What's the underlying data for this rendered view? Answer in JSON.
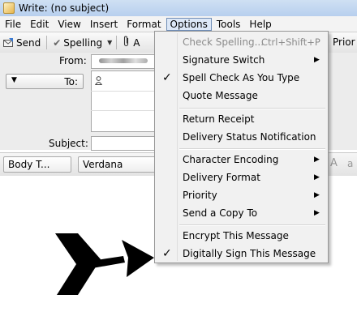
{
  "window": {
    "title": "Write: (no subject)"
  },
  "menubar": {
    "items": [
      {
        "label": "File",
        "active": false
      },
      {
        "label": "Edit",
        "active": false
      },
      {
        "label": "View",
        "active": false
      },
      {
        "label": "Insert",
        "active": false
      },
      {
        "label": "Format",
        "active": false
      },
      {
        "label": "Options",
        "active": true
      },
      {
        "label": "Tools",
        "active": false
      },
      {
        "label": "Help",
        "active": false
      }
    ]
  },
  "toolbar": {
    "send_label": "Send",
    "spelling_label": "Spelling",
    "attach_partial": "A",
    "priority_partial": "Prior"
  },
  "header": {
    "from_label": "From:",
    "to_label": "To:",
    "subject_label": "Subject:",
    "subject_value": ""
  },
  "format": {
    "body_text": "Body T...",
    "font": "Verdana",
    "size_large": "A",
    "size_small": "a"
  },
  "options_menu": {
    "items": [
      {
        "label": "Check Spelling...",
        "shortcut": "Ctrl+Shift+P",
        "enabled": false,
        "checked": false,
        "submenu": false
      },
      {
        "label": "Signature Switch",
        "shortcut": "",
        "enabled": true,
        "checked": false,
        "submenu": true
      },
      {
        "label": "Spell Check As You Type",
        "shortcut": "",
        "enabled": true,
        "checked": true,
        "submenu": false
      },
      {
        "label": "Quote Message",
        "shortcut": "",
        "enabled": true,
        "checked": false,
        "submenu": false
      },
      {
        "label": "Return Receipt",
        "shortcut": "",
        "enabled": true,
        "checked": false,
        "submenu": false
      },
      {
        "label": "Delivery Status Notification",
        "shortcut": "",
        "enabled": true,
        "checked": false,
        "submenu": false
      },
      {
        "label": "Character Encoding",
        "shortcut": "",
        "enabled": true,
        "checked": false,
        "submenu": true
      },
      {
        "label": "Delivery Format",
        "shortcut": "",
        "enabled": true,
        "checked": false,
        "submenu": true
      },
      {
        "label": "Priority",
        "shortcut": "",
        "enabled": true,
        "checked": false,
        "submenu": true
      },
      {
        "label": "Send a Copy To",
        "shortcut": "",
        "enabled": true,
        "checked": false,
        "submenu": true
      },
      {
        "label": "Encrypt This Message",
        "shortcut": "",
        "enabled": true,
        "checked": false,
        "submenu": false
      },
      {
        "label": "Digitally Sign This Message",
        "shortcut": "",
        "enabled": true,
        "checked": true,
        "submenu": false
      }
    ]
  },
  "icons": {
    "check_mark": "✓",
    "submenu_arrow": "▶",
    "dropdown_arrow": "▼"
  },
  "colors": {
    "menu_active_bg": "#dde8f7",
    "menu_active_border": "#6f8db6",
    "menu_bg": "#f1f1f1",
    "disabled_text": "#8b8b8b",
    "annotation_arrow": "#000000"
  }
}
